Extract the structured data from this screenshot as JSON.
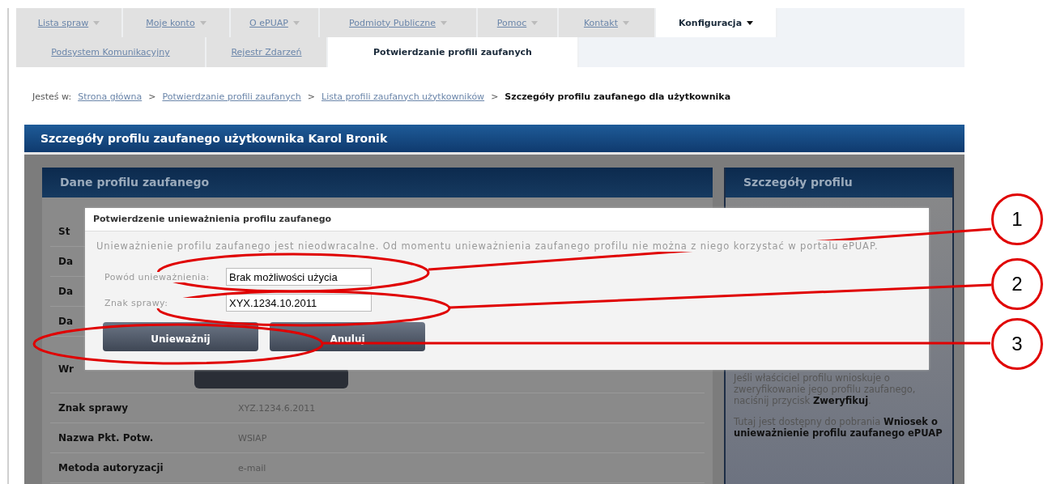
{
  "top_tabs": [
    {
      "label": "Lista spraw",
      "selected": false
    },
    {
      "label": "Moje konto",
      "selected": false
    },
    {
      "label": "O ePUAP",
      "selected": false
    },
    {
      "label": "Podmioty Publiczne",
      "selected": false
    },
    {
      "label": "Pomoc",
      "selected": false
    },
    {
      "label": "Kontakt",
      "selected": false
    },
    {
      "label": "Konfiguracja",
      "selected": true
    }
  ],
  "sub_tabs": [
    {
      "label": "Podsystem Komunikacyjny",
      "selected": false
    },
    {
      "label": "Rejestr Zdarzeń",
      "selected": false
    },
    {
      "label": "Potwierdzanie profili zaufanych",
      "selected": true
    }
  ],
  "breadcrumb": {
    "prefix": "Jesteś w:",
    "separator": ">",
    "items": [
      {
        "label": "Strona główna",
        "current": false
      },
      {
        "label": "Potwierdzanie profili zaufanych",
        "current": false
      },
      {
        "label": "Lista profili zaufanych użytkowników",
        "current": false
      },
      {
        "label": "Szczegóły profilu zaufanego dla użytkownika",
        "current": true
      }
    ]
  },
  "page_title": "Szczegóły profilu zaufanego użytkownika Karol Bronik",
  "profile_panel": {
    "title": "Dane profilu zaufanego",
    "rows": [
      {
        "kind": "field",
        "label": "St"
      },
      {
        "kind": "field",
        "label": "Da"
      },
      {
        "kind": "field",
        "label": "Da"
      },
      {
        "kind": "field",
        "label": "Da"
      },
      {
        "kind": "action",
        "label": "Wr"
      },
      {
        "kind": "field",
        "label": "Znak sprawy",
        "value": "XYZ.1234.6.2011"
      },
      {
        "kind": "field",
        "label": "Nazwa Pkt. Potw.",
        "value": "WSIAP"
      },
      {
        "kind": "field",
        "label": "Metoda autoryzacji",
        "value": "e-mail"
      }
    ]
  },
  "details_panel": {
    "title": "Szczegóły profilu",
    "paragraphs": [
      "Jeśli właściciel profilu wnioskuje o zweryfikowanie jego profilu zaufanego, naciśnij przycisk **Zweryfikuj**.",
      "Tutaj jest dostępny do pobrania **Wniosek o unieważnienie profilu zaufanego ePUAP**"
    ]
  },
  "dialog": {
    "title": "Potwierdzenie unieważnienia profilu zaufanego",
    "message": "Unieważnienie profilu zaufanego jest nieodwracalne. Od momentu unieważnienia zaufanego profilu nie można z niego korzystać w portalu ePUAP.",
    "fields": [
      {
        "label": "Powód unieważnienia:",
        "value": "Brak możliwości użycia"
      },
      {
        "label": "Znak sprawy:",
        "value": "XYX.1234.10.2011"
      }
    ],
    "buttons": [
      "Unieważnij",
      "Anuluj"
    ]
  },
  "callouts": [
    {
      "number": "1"
    },
    {
      "number": "2"
    },
    {
      "number": "3"
    }
  ]
}
